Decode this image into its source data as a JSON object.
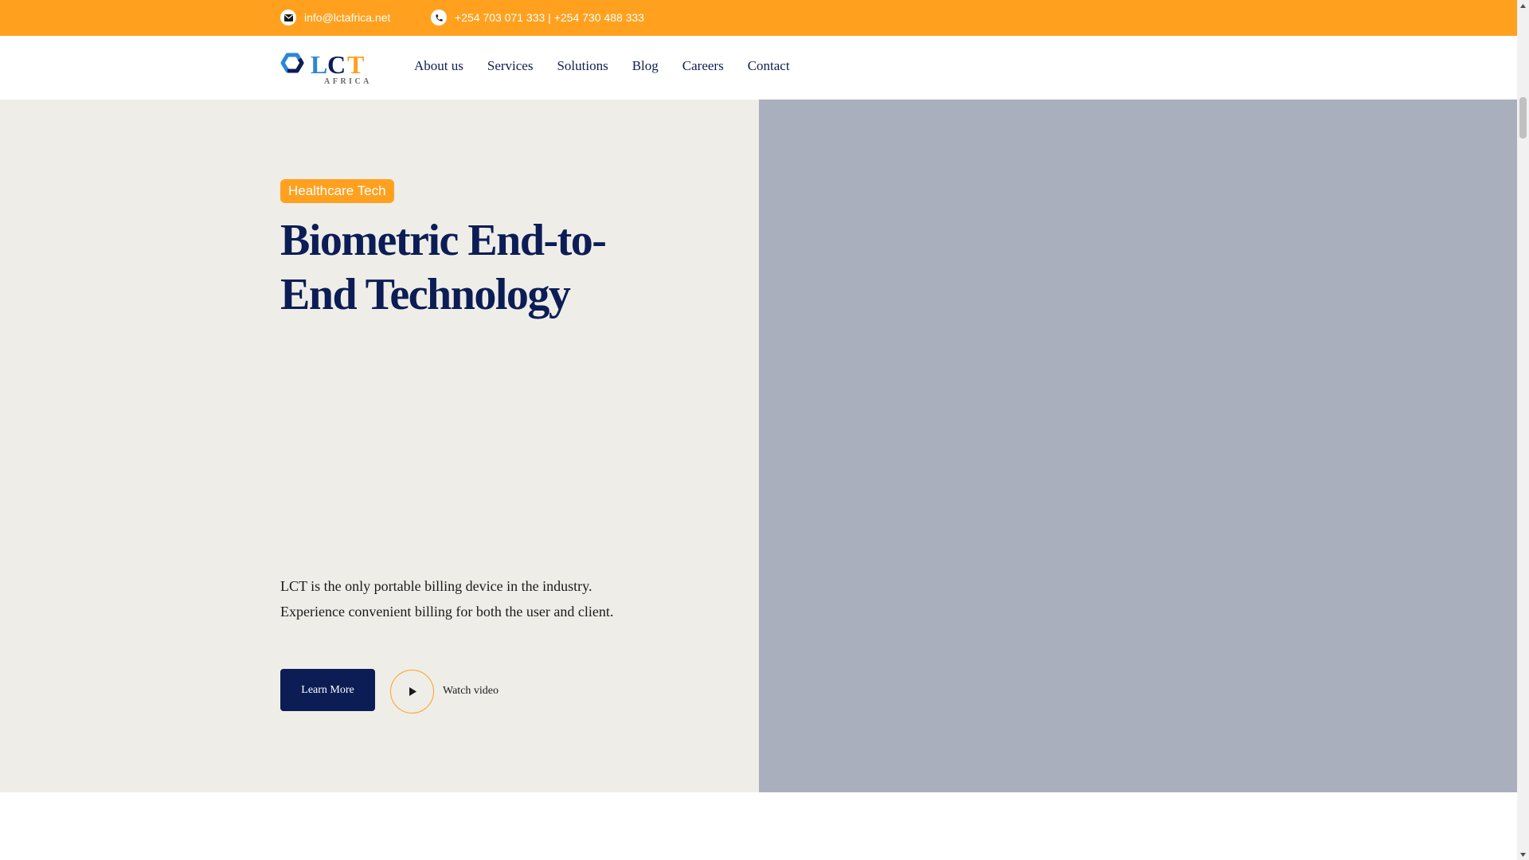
{
  "topbar": {
    "email": "info@lctafrica.net",
    "email_icon": "envelope-icon",
    "phone": "+254 703 071 333 | +254 730 488 333",
    "phone_icon": "phone-icon"
  },
  "brand": {
    "name": "LCT",
    "sub": "AFRICA",
    "colors": {
      "blue": "#2c86d6",
      "orange": "#ffa11f",
      "navy": "#0c1d55"
    }
  },
  "nav": {
    "items": [
      {
        "label": "About us"
      },
      {
        "label": "Services"
      },
      {
        "label": "Solutions"
      },
      {
        "label": "Blog"
      },
      {
        "label": "Careers"
      },
      {
        "label": "Contact"
      }
    ]
  },
  "hero": {
    "badge": "Healthcare Tech",
    "headline": "Biometric End-to-End Technology",
    "description": "LCT is the only portable billing device in the industry. Experience convenient billing for both the user and client.",
    "cta_label": "Learn More",
    "video_label": "Watch video",
    "play_icon": "play-icon"
  },
  "colors": {
    "accent": "#ffa11f",
    "navy": "#0c1d55",
    "hero_left_bg": "#eeede8",
    "hero_right_bg": "#a9afbc"
  }
}
